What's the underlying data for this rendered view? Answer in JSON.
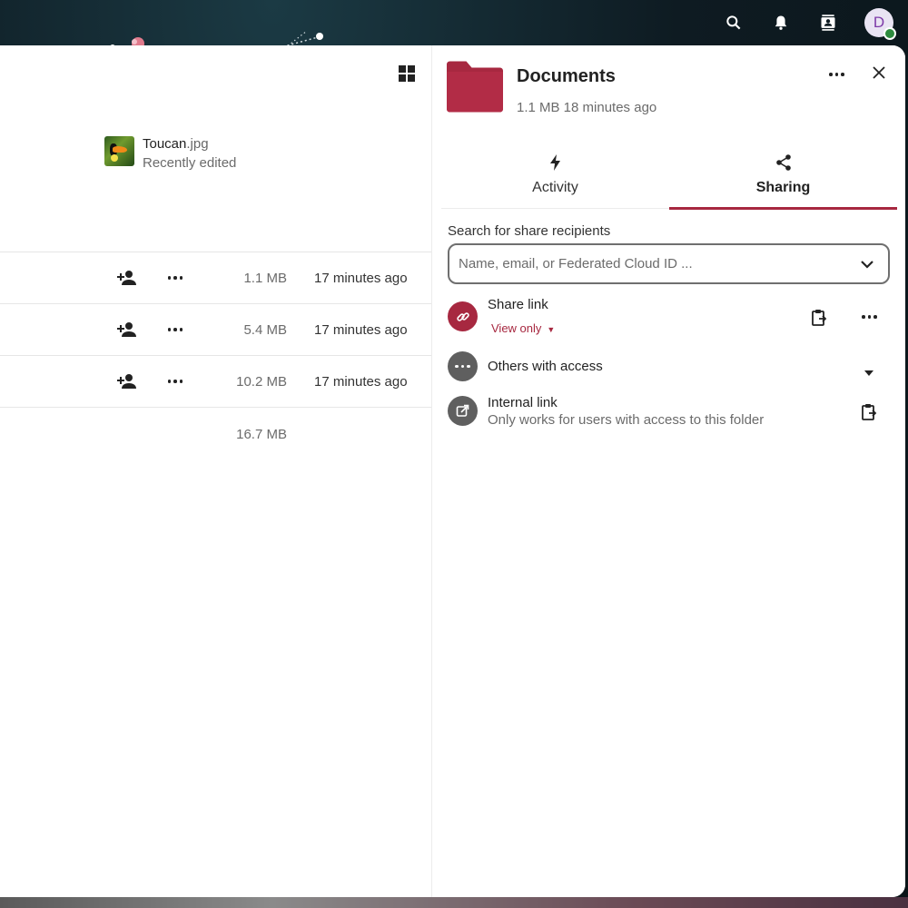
{
  "header": {
    "icons": [
      "search-icon",
      "notifications-icon",
      "contacts-icon"
    ],
    "avatar_initial": "D",
    "status_color": "#2d8a3e"
  },
  "filelist": {
    "view_toggle_icon": "grid-view-icon",
    "recent": {
      "name": "Toucan",
      "ext": ".jpg",
      "subtitle": "Recently edited"
    },
    "rows": [
      {
        "size": "1.1 MB",
        "modified": "17 minutes ago"
      },
      {
        "size": "5.4 MB",
        "modified": "17 minutes ago"
      },
      {
        "size": "10.2 MB",
        "modified": "17 minutes ago"
      }
    ],
    "total_size": "16.7 MB"
  },
  "sidebar": {
    "title": "Documents",
    "meta": "1.1 MB 18 minutes ago",
    "folder_color": "#a72840",
    "tabs": [
      {
        "label": "Activity",
        "icon": "activity-bolt-icon",
        "active": false
      },
      {
        "label": "Sharing",
        "icon": "share-icon",
        "active": true
      }
    ],
    "search": {
      "label": "Search for share recipients",
      "placeholder": "Name, email, or Federated Cloud ID ..."
    },
    "share_link": {
      "title": "Share link",
      "permission": "View only"
    },
    "others": {
      "title": "Others with access"
    },
    "internal_link": {
      "title": "Internal link",
      "subtitle": "Only works for users with access to this folder"
    }
  }
}
